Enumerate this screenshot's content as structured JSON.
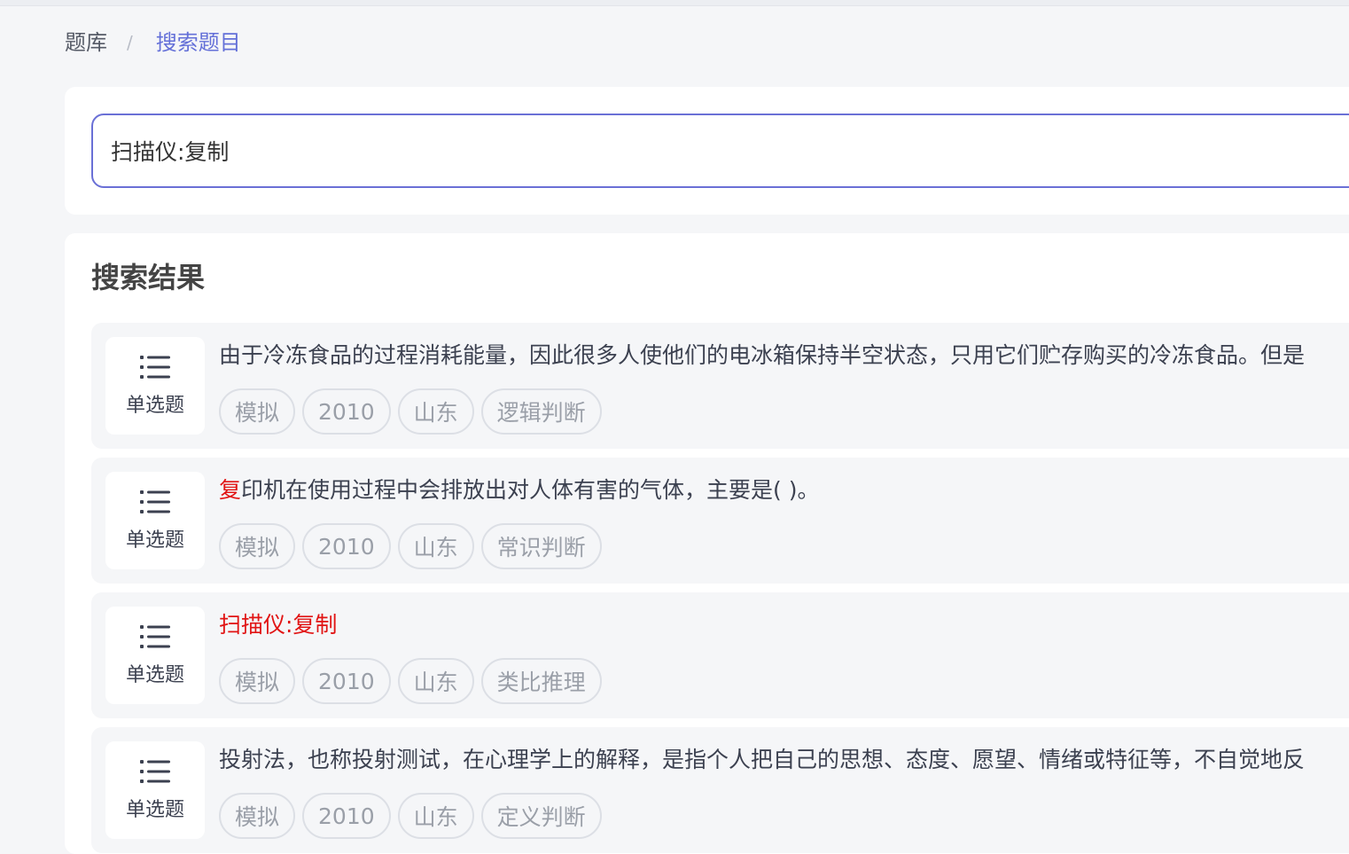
{
  "breadcrumb": {
    "root": "题库",
    "separator": "/",
    "current": "搜索题目"
  },
  "search": {
    "value": "扫描仪:复制"
  },
  "results": {
    "title": "搜索结果",
    "items": [
      {
        "type_label": "单选题",
        "text_hl": "",
        "text_rest": "由于冷冻食品的过程消耗能量，因此很多人使他们的电冰箱保持半空状态，只用它们贮存购买的冷冻食品。但是",
        "tags": [
          "模拟",
          "2010",
          "山东",
          "逻辑判断"
        ]
      },
      {
        "type_label": "单选题",
        "text_hl": "复",
        "text_rest": "印机在使用过程中会排放出对人体有害的气体，主要是( )。",
        "tags": [
          "模拟",
          "2010",
          "山东",
          "常识判断"
        ]
      },
      {
        "type_label": "单选题",
        "text_hl": "扫描仪:复制",
        "text_rest": "",
        "tags": [
          "模拟",
          "2010",
          "山东",
          "类比推理"
        ]
      },
      {
        "type_label": "单选题",
        "text_hl": "",
        "text_rest": "投射法，也称投射测试，在心理学上的解释，是指个人把自己的思想、态度、愿望、情绪或特征等，不自觉地反",
        "tags": [
          "模拟",
          "2010",
          "山东",
          "定义判断"
        ]
      }
    ]
  }
}
